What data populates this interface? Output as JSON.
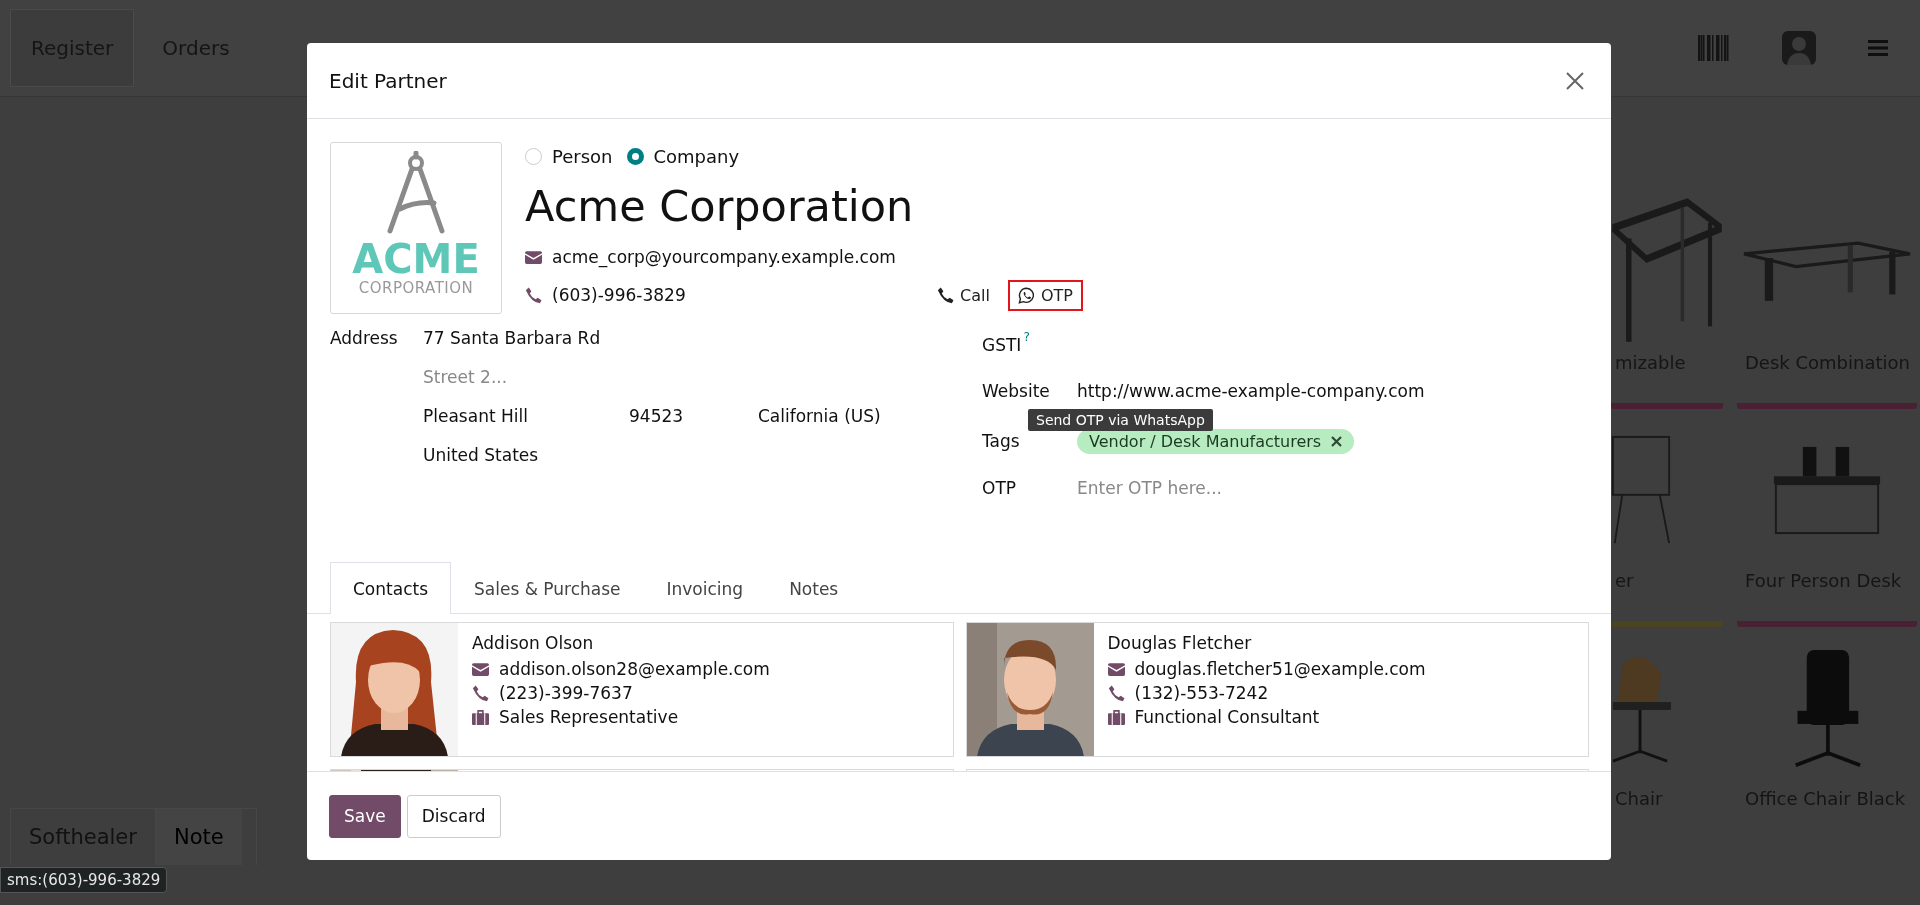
{
  "top_bar": {
    "tabs": [
      {
        "label": "Register",
        "selected": true
      },
      {
        "label": "Orders",
        "selected": false
      }
    ]
  },
  "products": [
    {
      "name": "mizable",
      "color": "#4a2035"
    },
    {
      "name": "Desk Combination",
      "color": "#4a2035"
    },
    {
      "name": "er",
      "color": "#4a4422"
    },
    {
      "name": "Four Person Desk",
      "color": "#4a2035"
    },
    {
      "name": "Chair"
    },
    {
      "name": "Office Chair Black"
    }
  ],
  "order_tabs": [
    {
      "label": "Softhealer",
      "selected": true
    },
    {
      "label": "Note",
      "selected": false
    }
  ],
  "status_url": "sms:(603)-996-3829",
  "dialog": {
    "title": "Edit Partner",
    "logo": {
      "title": "ACME",
      "subtitle": "CORPORATION"
    },
    "company_types": [
      {
        "label": "Person",
        "selected": false
      },
      {
        "label": "Company",
        "selected": true
      }
    ],
    "name": "Acme Corporation",
    "email": "acme_corp@yourcompany.example.com",
    "phone": "(603)-996-3829",
    "phone_actions": [
      {
        "kind": "call",
        "label": "Call",
        "highlighted": false
      },
      {
        "kind": "whatsapp",
        "label": "OTP",
        "highlighted": true
      }
    ],
    "tooltip": "Send OTP via WhatsApp",
    "address": {
      "label": "Address",
      "street": "77 Santa Barbara Rd",
      "street2_placeholder": "Street 2...",
      "city": "Pleasant Hill",
      "zip": "94523",
      "state": "California (US)",
      "country": "United States"
    },
    "fields": [
      {
        "kind": "text",
        "label": "GSTI",
        "help": "?"
      },
      {
        "kind": "text",
        "label": "Website",
        "value": "http://www.acme-example-company.com"
      },
      {
        "kind": "tags",
        "label": "Tags",
        "tags": [
          "Vendor / Desk Manufacturers"
        ]
      },
      {
        "kind": "input",
        "label": "OTP",
        "placeholder": "Enter OTP here..."
      }
    ],
    "tabs": [
      {
        "label": "Contacts",
        "selected": true
      },
      {
        "label": "Sales & Purchase",
        "selected": false
      },
      {
        "label": "Invoicing",
        "selected": false
      },
      {
        "label": "Notes",
        "selected": false
      }
    ],
    "contacts": [
      {
        "name": "Addison Olson",
        "email": "addison.olson28@example.com",
        "phone": "(223)-399-7637",
        "job": "Sales Representative"
      },
      {
        "name": "Douglas Fletcher",
        "email": "douglas.fletcher51@example.com",
        "phone": "(132)-553-7242",
        "job": "Functional Consultant"
      }
    ],
    "buttons": [
      {
        "kind": "primary",
        "label": "Save"
      },
      {
        "kind": "secondary",
        "label": "Discard"
      }
    ]
  }
}
